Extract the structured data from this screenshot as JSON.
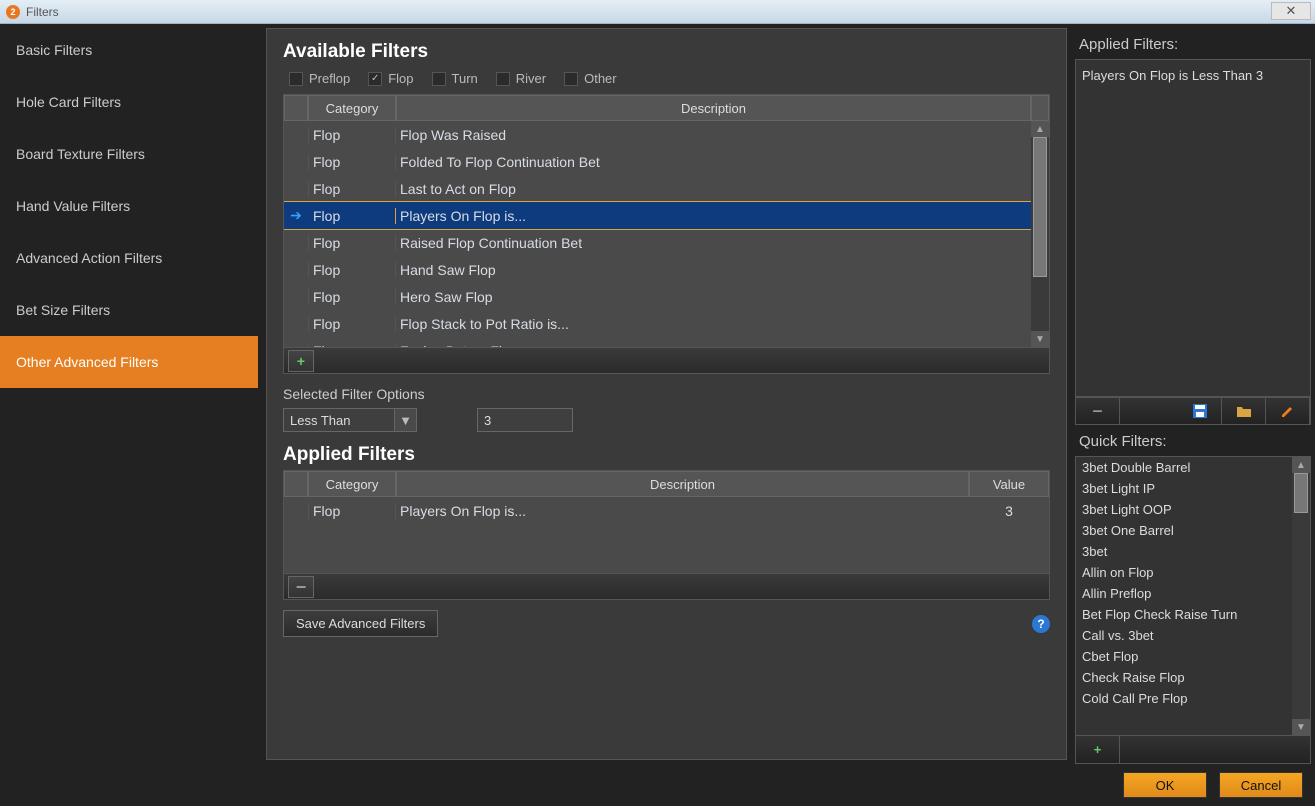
{
  "window": {
    "title": "Filters"
  },
  "sidebar": {
    "items": [
      {
        "label": "Basic Filters"
      },
      {
        "label": "Hole Card Filters"
      },
      {
        "label": "Board Texture Filters"
      },
      {
        "label": "Hand Value Filters"
      },
      {
        "label": "Advanced Action Filters"
      },
      {
        "label": "Bet Size Filters"
      },
      {
        "label": "Other Advanced Filters"
      }
    ],
    "active_index": 6
  },
  "available": {
    "heading": "Available Filters",
    "streets": {
      "preflop": {
        "label": "Preflop",
        "checked": false
      },
      "flop": {
        "label": "Flop",
        "checked": true
      },
      "turn": {
        "label": "Turn",
        "checked": false
      },
      "river": {
        "label": "River",
        "checked": false
      },
      "other": {
        "label": "Other",
        "checked": false
      }
    },
    "columns": {
      "category": "Category",
      "description": "Description"
    },
    "rows": [
      {
        "category": "Flop",
        "description": "Flop Was Raised"
      },
      {
        "category": "Flop",
        "description": "Folded To Flop Continuation Bet"
      },
      {
        "category": "Flop",
        "description": "Last to Act on Flop"
      },
      {
        "category": "Flop",
        "description": "Players On Flop is..."
      },
      {
        "category": "Flop",
        "description": "Raised Flop Continuation Bet"
      },
      {
        "category": "Flop",
        "description": "Hand Saw Flop"
      },
      {
        "category": "Flop",
        "description": "Hero Saw Flop"
      },
      {
        "category": "Flop",
        "description": "Flop Stack to Pot Ratio is..."
      },
      {
        "category": "Flop",
        "description": "Facing Bet on Flop"
      }
    ],
    "selected_index": 3,
    "add_label": "+"
  },
  "selected_options": {
    "heading": "Selected Filter Options",
    "comparator": "Less Than",
    "value": "3"
  },
  "applied": {
    "heading": "Applied Filters",
    "columns": {
      "category": "Category",
      "description": "Description",
      "value": "Value"
    },
    "rows": [
      {
        "category": "Flop",
        "description": "Players On Flop is...",
        "value": "3"
      }
    ],
    "remove_label": "−"
  },
  "save_button": "Save Advanced Filters",
  "right": {
    "applied_heading": "Applied Filters:",
    "applied_items": [
      "Players On Flop is Less Than 3"
    ],
    "quick_heading": "Quick Filters:",
    "quick_items": [
      "3bet Double Barrel",
      "3bet Light IP",
      "3bet Light OOP",
      "3bet One Barrel",
      "3bet",
      "Allin on Flop",
      "Allin Preflop",
      "Bet Flop Check Raise Turn",
      "Call vs. 3bet",
      "Cbet Flop",
      "Check Raise Flop",
      "Cold Call Pre Flop"
    ],
    "add_quick_label": "+"
  },
  "footer": {
    "ok": "OK",
    "cancel": "Cancel"
  }
}
